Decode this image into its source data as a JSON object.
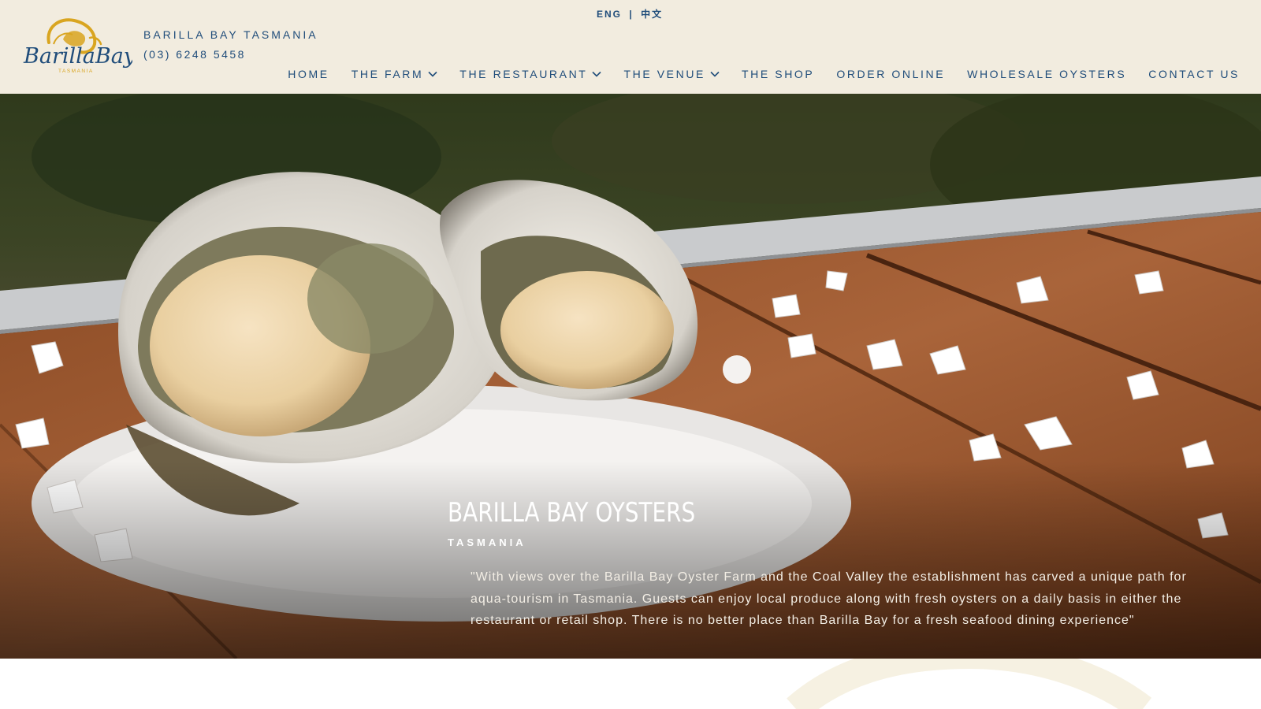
{
  "header": {
    "brand_name": "BARILLA BAY TASMANIA",
    "phone": "(03) 6248 5458",
    "logo_text": "BarillaBay",
    "logo_subtext": "TASMANIA",
    "lang": {
      "eng": "ENG",
      "separator": "|",
      "chinese": "中文"
    }
  },
  "nav": {
    "items": [
      {
        "label": "HOME",
        "has_dropdown": false
      },
      {
        "label": "THE FARM",
        "has_dropdown": true
      },
      {
        "label": "THE RESTAURANT",
        "has_dropdown": true
      },
      {
        "label": "THE VENUE",
        "has_dropdown": true
      },
      {
        "label": "THE SHOP",
        "has_dropdown": false
      },
      {
        "label": "ORDER ONLINE",
        "has_dropdown": false
      },
      {
        "label": "WHOLESALE OYSTERS",
        "has_dropdown": false
      },
      {
        "label": "CONTACT US",
        "has_dropdown": false
      }
    ]
  },
  "hero": {
    "title": "BARILLA BAY OYSTERS",
    "subtitle": "TASMANIA",
    "quote": "\"With views over the Barilla Bay Oyster Farm and the Coal Valley the establishment has carved a unique path for aqua-tourism in Tasmania. Guests can enjoy local produce along with fresh oysters on a daily basis in either the restaurant or retail shop.  There is no better place than Barilla Bay for a fresh seafood dining experience\"",
    "image_icon": "oysters-on-salt-photo"
  },
  "colors": {
    "header_bg": "#f2ecdf",
    "brand_blue": "#1f4c7a",
    "logo_gold": "#d9a520",
    "hero_text": "#ffffff"
  }
}
